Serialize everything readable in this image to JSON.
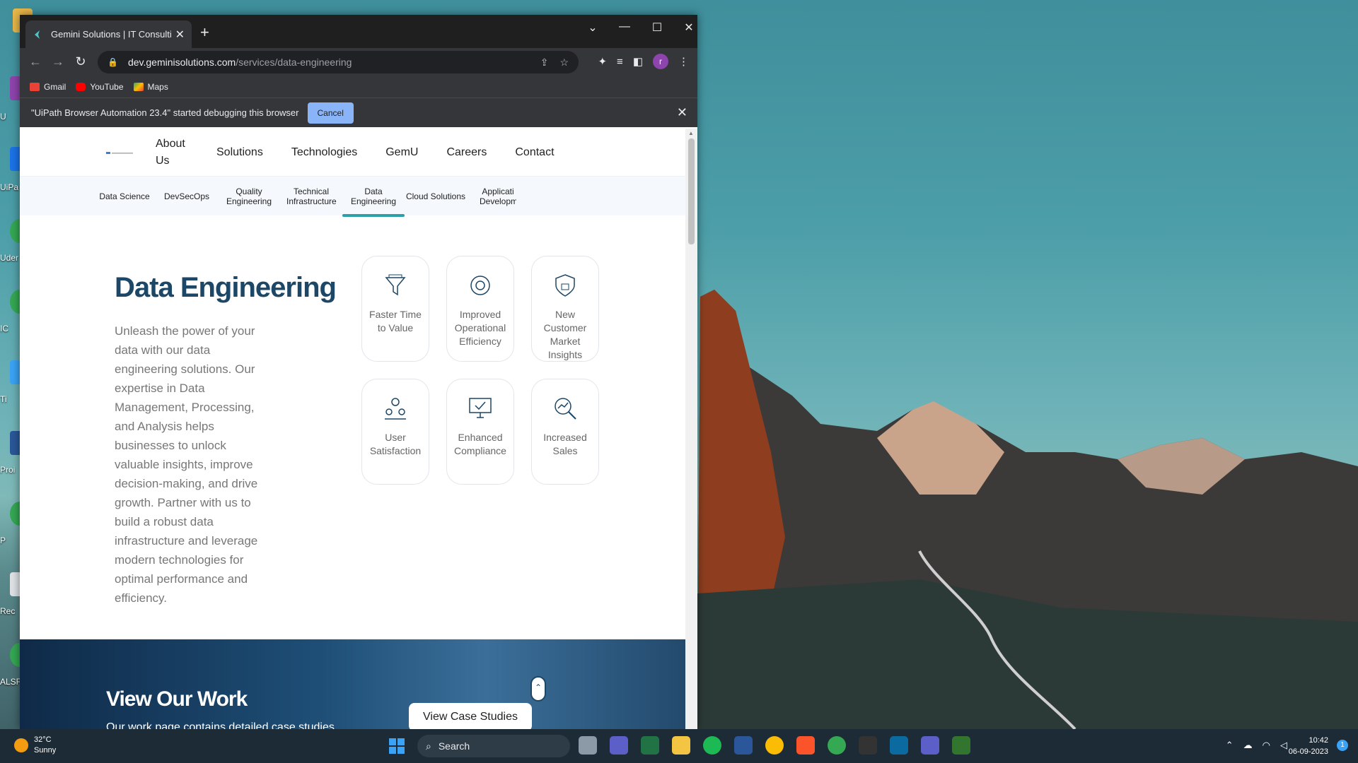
{
  "browser": {
    "tab_title": "Gemini Solutions | IT Consulting,",
    "url_host": "dev.geminisolutions.com",
    "url_path": "/services/data-engineering",
    "avatar_letter": "r",
    "bookmarks": [
      "Gmail",
      "YouTube",
      "Maps"
    ],
    "infobar_text": "\"UiPath Browser Automation 23.4\" started debugging this browser",
    "infobar_cancel": "Cancel"
  },
  "site": {
    "nav": [
      "About Us",
      "Solutions",
      "Technologies",
      "GemU",
      "Careers",
      "Contact"
    ],
    "subnav": [
      "Data Science",
      "DevSecOps",
      "Quality Engineering",
      "Technical Infrastructure",
      "Data Engineering",
      "Cloud Solutions",
      "Applicati Developm"
    ],
    "hero_title": "Data Engineering",
    "hero_text": "Unleash the power of your data with our data engineering solutions. Our expertise in Data Management, Processing, and Analysis helps businesses to unlock valuable insights, improve decision-making, and drive growth. Partner with us to build a robust data infrastructure and leverage modern technologies for optimal performance and efficiency.",
    "cards": [
      {
        "label": "Faster Time to Value",
        "icon": "funnel-icon"
      },
      {
        "label": "Improved Operational Efficiency",
        "icon": "gear-cycle-icon"
      },
      {
        "label": "New Customer Market Insights",
        "icon": "shield-lock-icon"
      },
      {
        "label": "User Satisfaction",
        "icon": "users-icon"
      },
      {
        "label": "Enhanced Compliance",
        "icon": "monitor-check-icon"
      },
      {
        "label": "Increased Sales",
        "icon": "magnifier-chart-icon"
      }
    ],
    "work_title": "View Our Work",
    "work_sub": "Our work page contains detailed case studies",
    "case_button": "View Case Studies"
  },
  "taskbar": {
    "temp": "32°C",
    "weather": "Sunny",
    "search": "Search",
    "time": "10:42",
    "date": "06-09-2023",
    "notif_count": "1"
  },
  "desktop_labels": [
    "U",
    "UiPa",
    "Uder",
    "IC",
    "Ti",
    "Proi",
    "P",
    "Rec",
    "ALSF"
  ]
}
